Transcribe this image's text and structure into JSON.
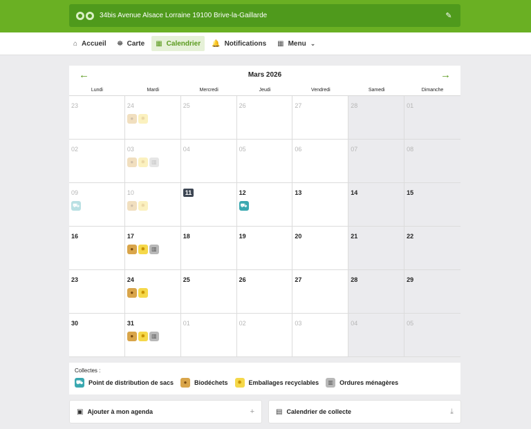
{
  "header": {
    "address": "34bis Avenue Alsace Lorraine 19100 Brive-la-Gaillarde",
    "logo_icon": "recycle-logo-icon",
    "edit_icon": "pencil-icon"
  },
  "nav": {
    "items": [
      {
        "label": "Accueil",
        "icon": "home-icon",
        "glyph": "⌂"
      },
      {
        "label": "Carte",
        "icon": "map-icon",
        "glyph": "⛯"
      },
      {
        "label": "Calendrier",
        "icon": "calendar-icon",
        "glyph": "▦"
      },
      {
        "label": "Notifications",
        "icon": "bell-icon",
        "glyph": "🔔"
      },
      {
        "label": "Menu",
        "icon": "grid-icon",
        "glyph": "▦"
      }
    ],
    "active": "Calendrier"
  },
  "calendar": {
    "month": "Mars 2026",
    "days_of_week": [
      "Lundi",
      "Mardi",
      "Mercredi",
      "Jeudi",
      "Vendredi",
      "Samedi",
      "Dimanche"
    ],
    "today": "11",
    "weeks": [
      [
        {
          "d": "23",
          "m": true,
          "c": []
        },
        {
          "d": "24",
          "m": true,
          "c": [
            "bio",
            "emb"
          ]
        },
        {
          "d": "25",
          "m": true,
          "c": []
        },
        {
          "d": "26",
          "m": true,
          "c": []
        },
        {
          "d": "27",
          "m": true,
          "c": []
        },
        {
          "d": "28",
          "m": true,
          "c": []
        },
        {
          "d": "01",
          "m": true,
          "c": []
        }
      ],
      [
        {
          "d": "02",
          "m": true,
          "c": []
        },
        {
          "d": "03",
          "m": true,
          "c": [
            "bio",
            "emb",
            "om"
          ]
        },
        {
          "d": "04",
          "m": true,
          "c": []
        },
        {
          "d": "05",
          "m": true,
          "c": []
        },
        {
          "d": "06",
          "m": true,
          "c": []
        },
        {
          "d": "07",
          "m": true,
          "c": []
        },
        {
          "d": "08",
          "m": true,
          "c": []
        }
      ],
      [
        {
          "d": "09",
          "m": true,
          "c": [
            "pds"
          ]
        },
        {
          "d": "10",
          "m": true,
          "c": [
            "bio",
            "emb"
          ]
        },
        {
          "d": "11",
          "m": false,
          "c": []
        },
        {
          "d": "12",
          "m": false,
          "c": [
            "pds"
          ]
        },
        {
          "d": "13",
          "m": false,
          "c": []
        },
        {
          "d": "14",
          "m": false,
          "c": []
        },
        {
          "d": "15",
          "m": false,
          "c": []
        }
      ],
      [
        {
          "d": "16",
          "m": false,
          "c": []
        },
        {
          "d": "17",
          "m": false,
          "c": [
            "bio",
            "emb",
            "om"
          ]
        },
        {
          "d": "18",
          "m": false,
          "c": []
        },
        {
          "d": "19",
          "m": false,
          "c": []
        },
        {
          "d": "20",
          "m": false,
          "c": []
        },
        {
          "d": "21",
          "m": false,
          "c": []
        },
        {
          "d": "22",
          "m": false,
          "c": []
        }
      ],
      [
        {
          "d": "23",
          "m": false,
          "c": []
        },
        {
          "d": "24",
          "m": false,
          "c": [
            "bio",
            "emb"
          ]
        },
        {
          "d": "25",
          "m": false,
          "c": []
        },
        {
          "d": "26",
          "m": false,
          "c": []
        },
        {
          "d": "27",
          "m": false,
          "c": []
        },
        {
          "d": "28",
          "m": false,
          "c": []
        },
        {
          "d": "29",
          "m": false,
          "c": []
        }
      ],
      [
        {
          "d": "30",
          "m": false,
          "c": []
        },
        {
          "d": "31",
          "m": false,
          "c": [
            "bio",
            "emb",
            "om"
          ]
        },
        {
          "d": "01",
          "m": true,
          "c": []
        },
        {
          "d": "02",
          "m": true,
          "c": []
        },
        {
          "d": "03",
          "m": true,
          "c": []
        },
        {
          "d": "04",
          "m": true,
          "c": []
        },
        {
          "d": "05",
          "m": true,
          "c": []
        }
      ]
    ]
  },
  "collection_types": {
    "pds": {
      "label": "Point de distribution de sacs",
      "icon": "bag-distribution-icon",
      "glyph": "⛟",
      "color": "#3aa8b0"
    },
    "bio": {
      "label": "Biodéchets",
      "icon": "apple-icon",
      "glyph": "●",
      "color": "#d9a54a"
    },
    "emb": {
      "label": "Emballages recyclables",
      "icon": "recycle-icon",
      "glyph": "✹",
      "color": "#f5d84a"
    },
    "om": {
      "label": "Ordures ménagères",
      "icon": "trash-icon",
      "glyph": "▥",
      "color": "#b8b8b8"
    }
  },
  "legend": {
    "title": "Collectes :",
    "order": [
      "pds",
      "bio",
      "emb",
      "om"
    ]
  },
  "actions": {
    "agenda": {
      "label": "Ajouter à mon agenda",
      "icon": "calendar-add-icon",
      "end": "+"
    },
    "download": {
      "label": "Calendrier de collecte",
      "icon": "file-icon",
      "end": "⤓"
    }
  }
}
